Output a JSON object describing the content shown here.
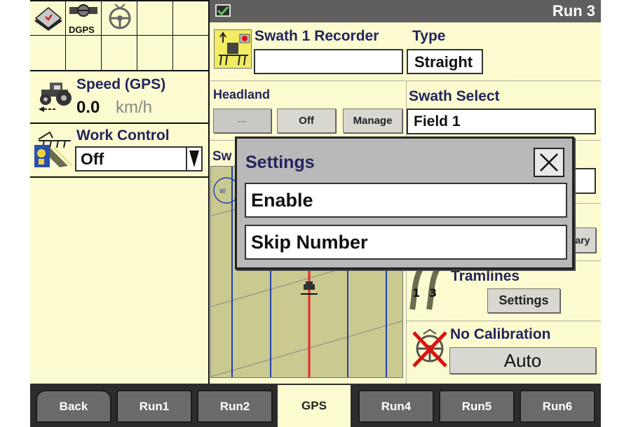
{
  "header": {
    "title": "Run 3",
    "status_icon": "checkbox-icon"
  },
  "left_panel": {
    "icons": [
      {
        "name": "home-icon"
      },
      {
        "name": "dgps-icon",
        "label": "DGPS"
      },
      {
        "name": "steering-wheel-icon"
      }
    ],
    "speed": {
      "label": "Speed (GPS)",
      "value": "0.0",
      "unit": "km/h",
      "icon": "tractor-icon"
    },
    "work_control": {
      "label": "Work Control",
      "value": "Off",
      "icon": "implement-icon"
    }
  },
  "swath_recorder": {
    "label": "Swath 1 Recorder",
    "value": ""
  },
  "type": {
    "label": "Type",
    "value": "Straight"
  },
  "headland": {
    "label": "Headland",
    "buttons": [
      "---",
      "Off",
      "Manage"
    ]
  },
  "swath_select": {
    "label": "Swath Select",
    "value": "Field 1"
  },
  "partial": {
    "sw_label": "Sw",
    "boundary_label": "lary",
    "tramlines_label": "Tramlines",
    "settings_button": "Settings"
  },
  "calibration": {
    "label": "No Calibration",
    "button": "Auto"
  },
  "dialog": {
    "title": "Settings",
    "items": [
      "Enable",
      "Skip Number"
    ]
  },
  "tabs": [
    "Back",
    "Run1",
    "Run2",
    "GPS",
    "Run4",
    "Run5",
    "Run6"
  ],
  "active_tab": "GPS",
  "colors": {
    "background": "#fbfbcf",
    "title_text": "#24245e",
    "guidance_line": "#e8282a",
    "swath_line": "#2540a8"
  }
}
